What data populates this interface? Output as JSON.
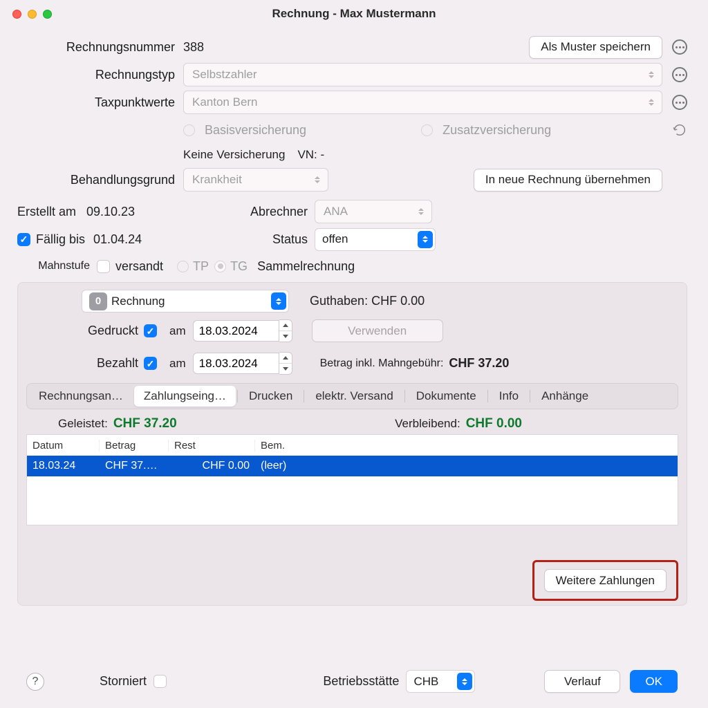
{
  "window_title": "Rechnung - Max Mustermann",
  "header": {
    "invoice_number_label": "Rechnungsnummer",
    "invoice_number": "388",
    "save_as_template": "Als Muster speichern",
    "invoice_type_label": "Rechnungstyp",
    "invoice_type": "Selbstzahler",
    "taxpoint_label": "Taxpunktwerte",
    "taxpoint": "Kanton Bern",
    "basic_insurance": "Basisversicherung",
    "additional_insurance": "Zusatzversicherung",
    "no_insurance": "Keine Versicherung",
    "vn_label": "VN: -",
    "reason_label": "Behandlungsgrund",
    "reason": "Krankheit",
    "copy_to_new": "In neue Rechnung übernehmen"
  },
  "dates": {
    "created_label": "Erstellt am",
    "created": "09.10.23",
    "biller_label": "Abrechner",
    "biller": "ANA",
    "due_label": "Fällig bis",
    "due": "01.04.24",
    "status_label": "Status",
    "status": "offen"
  },
  "reminder": {
    "level_label": "Mahnstufe",
    "sent": "versandt",
    "tp": "TP",
    "tg": "TG",
    "collect": "Sammelrechnung"
  },
  "panel": {
    "doc_count": "0",
    "doc_type": "Rechnung",
    "credit_label": "Guthaben: CHF 0.00",
    "printed_label": "Gedruckt",
    "am1": "am",
    "printed_date": "18.03.2024",
    "use_btn": "Verwenden",
    "paid_label": "Bezahlt",
    "am2": "am",
    "paid_date": "18.03.2024",
    "amount_label": "Betrag inkl. Mahngebühr:",
    "amount": "CHF 37.20"
  },
  "tabs": [
    "Rechnungsan…",
    "Zahlungseing…",
    "Drucken",
    "elektr. Versand",
    "Dokumente",
    "Info",
    "Anhänge"
  ],
  "summary": {
    "paid_label": "Geleistet:",
    "paid": "CHF 37.20",
    "remain_label": "Verbleibend:",
    "remain": "CHF 0.00"
  },
  "table": {
    "cols": [
      "Datum",
      "Betrag",
      "Rest",
      "Bem."
    ],
    "row": {
      "date": "18.03.24",
      "amount": "CHF 37.…",
      "rest": "CHF 0.00",
      "note": "(leer)"
    }
  },
  "more_payments": "Weitere Zahlungen",
  "footer": {
    "cancelled": "Storniert",
    "site_label": "Betriebsstätte",
    "site": "CHB",
    "history": "Verlauf",
    "ok": "OK"
  }
}
